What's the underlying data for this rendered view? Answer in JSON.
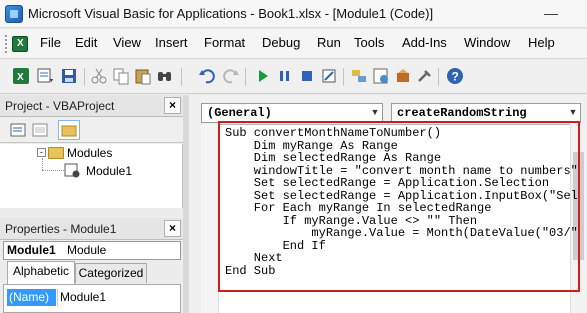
{
  "window": {
    "title": "Microsoft Visual Basic for Applications - Book1.xlsx - [Module1 (Code)]"
  },
  "menu": {
    "items": [
      {
        "label": "File"
      },
      {
        "label": "Edit"
      },
      {
        "label": "View"
      },
      {
        "label": "Insert"
      },
      {
        "label": "Format"
      },
      {
        "label": "Debug"
      },
      {
        "label": "Run"
      },
      {
        "label": "Tools"
      },
      {
        "label": "Add-Ins"
      },
      {
        "label": "Window"
      },
      {
        "label": "Help"
      }
    ]
  },
  "toolbar": {
    "icons": [
      "excel-icon",
      "insert-module-icon",
      "save-icon",
      "cut-icon",
      "copy-icon",
      "paste-icon",
      "find-icon",
      "undo-icon",
      "redo-icon",
      "run-icon",
      "break-icon",
      "reset-icon",
      "design-mode-icon",
      "project-explorer-icon",
      "properties-icon",
      "object-browser-icon",
      "toolbox-icon",
      "help-icon"
    ]
  },
  "project_pane": {
    "title": "Project - VBAProject",
    "close": "×",
    "tree": [
      {
        "label": "Modules"
      },
      {
        "label": "Module1"
      }
    ]
  },
  "properties_pane": {
    "title": "Properties - Module1",
    "close": "×",
    "object_name": "Module1",
    "object_type": "Module",
    "tabs": [
      {
        "label": "Alphabetic"
      },
      {
        "label": "Categorized"
      }
    ],
    "rows": [
      {
        "name": "(Name)",
        "value": "Module1"
      }
    ]
  },
  "code_window": {
    "object_combo": "(General)",
    "procedure_combo": "createRandomString",
    "lines": [
      "Sub convertMonthNameToNumber()",
      "    Dim myRange As Range",
      "    Dim selectedRange As Range",
      "    windowTitle = \"convert month name to numbers\"",
      "    Set selectedRange = Application.Selection",
      "    Set selectedRange = Application.InputBox(\"Select",
      "    For Each myRange In selectedRange",
      "        If myRange.Value <> \"\" Then",
      "            myRange.Value = Month(DateValue(\"03/\"",
      "        End If",
      "    Next",
      "End Sub"
    ]
  }
}
